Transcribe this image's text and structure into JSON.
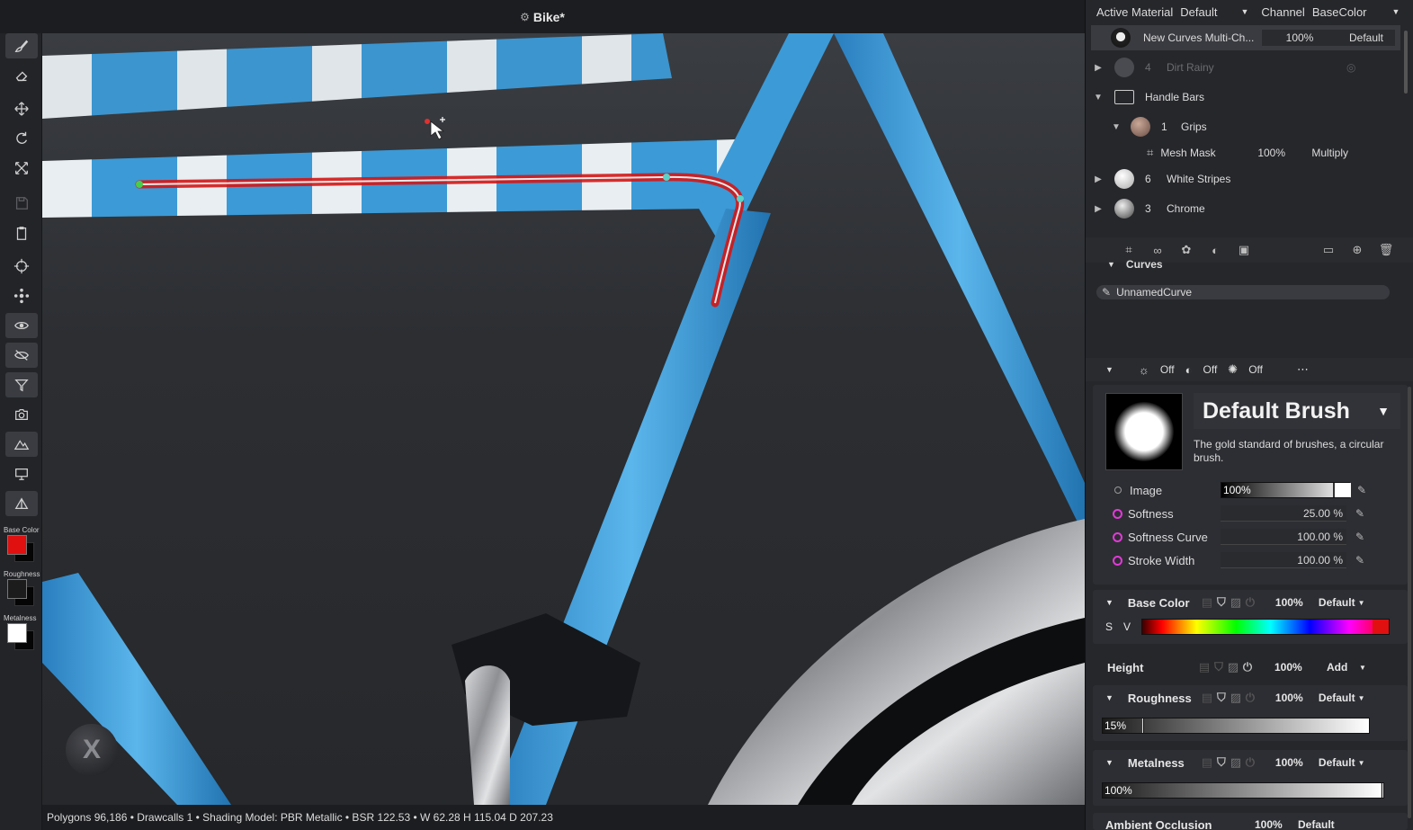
{
  "window": {
    "title": "Bike*"
  },
  "toolbar": {
    "swatches": [
      {
        "label": "Base Color",
        "color": "#e01010"
      },
      {
        "label": "Roughness",
        "color": "#1c1c1c"
      },
      {
        "label": "Metalness",
        "color": "#ffffff"
      }
    ]
  },
  "viewport": {
    "gizmo_label": "X"
  },
  "status": {
    "text": "Polygons 96,186 • Drawcalls 1 • Shading Model: PBR Metallic • BSR 122.53 • W 62.28 H 115.04 D 207.23"
  },
  "header": {
    "active_material_label": "Active Material",
    "active_material_value": "Default",
    "channel_label": "Channel",
    "channel_value": "BaseColor"
  },
  "layers": [
    {
      "name": "New Curves Multi-Ch...",
      "opacity": "100%",
      "blend": "Default"
    },
    {
      "index": "4",
      "name": "Dirt Rainy"
    },
    {
      "name": "Handle Bars"
    },
    {
      "index": "1",
      "name": "Grips"
    },
    {
      "name": "Mesh Mask",
      "opacity": "100%",
      "blend": "Multiply"
    },
    {
      "index": "6",
      "name": "White Stripes"
    },
    {
      "index": "3",
      "name": "Chrome"
    }
  ],
  "curves": {
    "title": "Curves",
    "item": "UnnamedCurve"
  },
  "brush_toggles": [
    "Off",
    "Off",
    "Off"
  ],
  "brush": {
    "name": "Default Brush",
    "description": "The gold standard of brushes, a circular brush.",
    "params": [
      {
        "label": "Image",
        "value": "100%"
      },
      {
        "label": "Softness",
        "value": "25.00 %"
      },
      {
        "label": "Softness Curve",
        "value": "100.00 %"
      },
      {
        "label": "Stroke Width",
        "value": "100.00 %"
      }
    ]
  },
  "channels": {
    "base_color": {
      "title": "Base Color",
      "opacity": "100%",
      "blend": "Default",
      "s": "S",
      "v": "V",
      "color": "#e01010"
    },
    "height": {
      "title": "Height",
      "opacity": "100%",
      "blend": "Add"
    },
    "roughness": {
      "title": "Roughness",
      "opacity": "100%",
      "blend": "Default",
      "value": "15%",
      "level": 0.15
    },
    "metalness": {
      "title": "Metalness",
      "opacity": "100%",
      "blend": "Default",
      "value": "100%",
      "level": 1.0
    },
    "ambient": {
      "title": "Ambient Occlusion",
      "opacity": "100%",
      "blend": "Default"
    }
  }
}
